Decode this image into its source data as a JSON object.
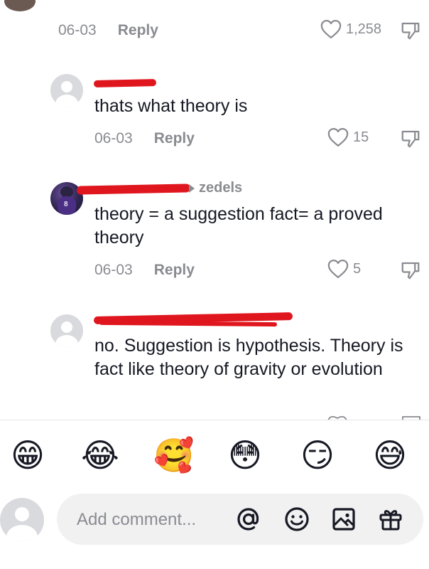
{
  "comment_top_meta": {
    "date": "06-03",
    "reply": "Reply",
    "likes": "1,258"
  },
  "comments": [
    {
      "text": "thats what theory is",
      "date": "06-03",
      "reply": "Reply",
      "likes": "15"
    },
    {
      "reply_to": "zedels",
      "text": "theory = a suggestion fact= a proved theory",
      "date": "06-03",
      "reply": "Reply",
      "likes": "5"
    },
    {
      "text": "no. Suggestion is hypothesis. Theory is fact like theory of gravity or evolution"
    }
  ],
  "emojis": [
    "😁",
    "😂",
    "🥰",
    "😳",
    "😏",
    "😅"
  ],
  "composer": {
    "placeholder": "Add comment..."
  },
  "icons": [
    "heart-icon",
    "dislike-icon",
    "at-icon",
    "emoji-icon",
    "image-icon",
    "gift-icon",
    "default-avatar-icon"
  ],
  "colors": {
    "redaction": "#e0161e",
    "muted_text": "#8a8b91",
    "composer_bg": "#f1f1f2"
  }
}
